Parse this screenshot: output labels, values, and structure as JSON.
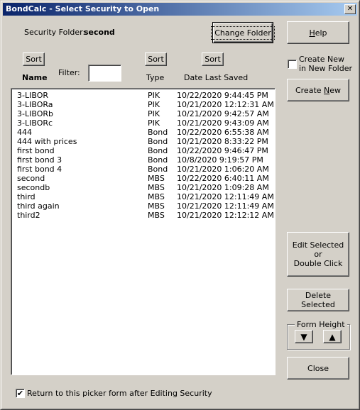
{
  "window": {
    "title": "BondCalc - Select Security to Open",
    "close_glyph": "✕"
  },
  "folder": {
    "label": "Security Folder:",
    "value": "second",
    "change_button": "Change Folder"
  },
  "columns": {
    "sort_label": "Sort",
    "name_header": "Name",
    "filter_label": "Filter:",
    "filter_value": "",
    "type_header": "Type",
    "date_header": "Date Last Saved"
  },
  "securities": [
    {
      "name": "3-LIBOR",
      "type": "PIK",
      "date": "10/22/2020 9:44:45 PM"
    },
    {
      "name": "3-LIBORa",
      "type": "PIK",
      "date": "10/21/2020 12:12:31 AM"
    },
    {
      "name": "3-LIBORb",
      "type": "PIK",
      "date": "10/21/2020 9:42:57 AM"
    },
    {
      "name": "3-LIBORc",
      "type": "PIK",
      "date": "10/21/2020 9:43:09 AM"
    },
    {
      "name": "444",
      "type": "Bond",
      "date": "10/22/2020 6:55:38 AM"
    },
    {
      "name": "444 with prices",
      "type": "Bond",
      "date": "10/21/2020 8:33:22 PM"
    },
    {
      "name": "first bond",
      "type": "Bond",
      "date": "10/22/2020 9:46:47 PM"
    },
    {
      "name": "first bond 3",
      "type": "Bond",
      "date": "10/8/2020 9:19:57 PM"
    },
    {
      "name": "first bond 4",
      "type": "Bond",
      "date": "10/21/2020 1:06:20 AM"
    },
    {
      "name": "second",
      "type": "MBS",
      "date": "10/22/2020 6:40:11 AM"
    },
    {
      "name": "secondb",
      "type": "MBS",
      "date": "10/21/2020 1:09:28 AM"
    },
    {
      "name": "third",
      "type": "MBS",
      "date": "10/21/2020 12:11:49 AM"
    },
    {
      "name": "third again",
      "type": "MBS",
      "date": "10/21/2020 12:11:49 AM"
    },
    {
      "name": "third2",
      "type": "MBS",
      "date": "10/21/2020 12:12:12 AM"
    }
  ],
  "sidebar": {
    "help_pre": "",
    "help_accel": "H",
    "help_post": "elp",
    "create_new_folder_line1": "Create New",
    "create_new_folder_line2": "in New Folder",
    "create_new_folder_checked": false,
    "create_new_pre": "Create ",
    "create_new_accel": "N",
    "create_new_post": "ew",
    "edit_line1": "Edit Selected",
    "edit_line2": "or",
    "edit_line3": "Double Click",
    "delete_label": "Delete Selected",
    "form_height_label": "Form Height",
    "down_glyph": "▼",
    "up_glyph": "▲",
    "close_label": "Close"
  },
  "footer": {
    "return_label": "Return to this picker form after Editing Security",
    "return_checked": true,
    "check_glyph": "✔"
  }
}
